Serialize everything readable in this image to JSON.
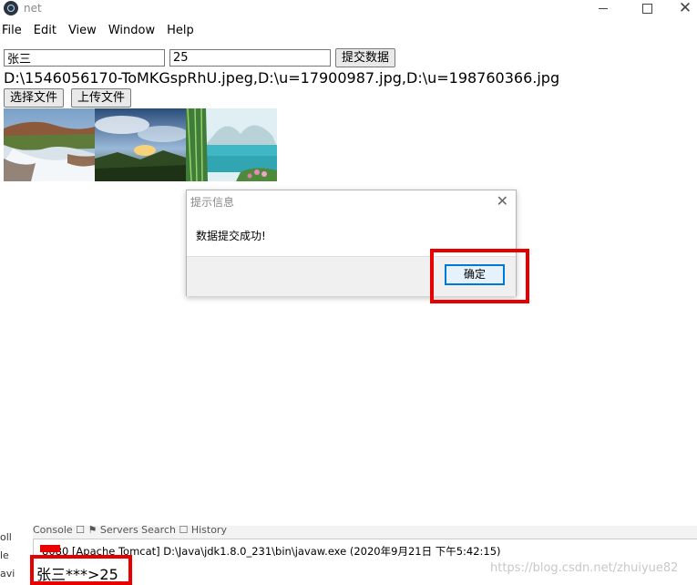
{
  "window": {
    "title": "net",
    "close_glyph": "✕"
  },
  "menu": [
    "File",
    "Edit",
    "View",
    "Window",
    "Help"
  ],
  "form": {
    "name_value": "张三",
    "age_value": "25",
    "submit_label": "提交数据",
    "file_paths": "D:\\1546056170-ToMKGspRhU.jpeg,D:\\u=17900987.jpg,D:\\u=198760366.jpg",
    "choose_file_label": "选择文件",
    "upload_label": "上传文件"
  },
  "thumbnails": [
    {
      "icon": "waterfall-image"
    },
    {
      "icon": "sunset-sky-image"
    },
    {
      "icon": "lake-bamboo-image"
    }
  ],
  "dialog": {
    "title": "提示信息",
    "close_glyph": "✕",
    "message": "数据提交成功!",
    "ok_label": "确定"
  },
  "console": {
    "tabs_text": "Console ☐  ⚑ Servers  Search  ☐ History",
    "left_lines": [
      "oll",
      "le",
      "avi"
    ],
    "server_line": "8080 [Apache Tomcat] D:\\Java\\jdk1.8.0_231\\bin\\javaw.exe  (2020年9月21日 下午5:42:15)",
    "output": "张三***>25",
    "watermark": "https://blog.csdn.net/zhuiyue82"
  },
  "colors": {
    "highlight": "#e80000",
    "ok_border": "#0078d7"
  }
}
